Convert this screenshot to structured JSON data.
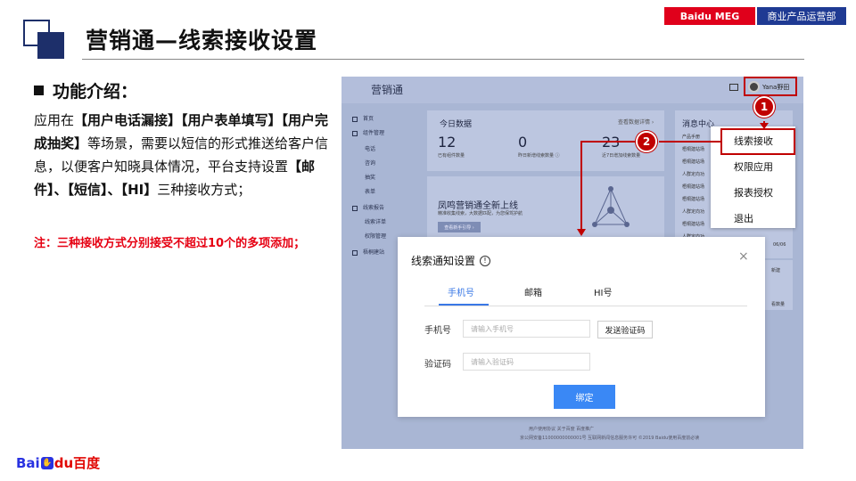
{
  "header": {
    "tag_meg": "Baidu MEG",
    "tag_dept": "商业产品运营部",
    "title": "营销通—线索接收设置"
  },
  "intro": {
    "heading": "功能介绍：",
    "line1_prefix": "应用在",
    "s1": "【用户电话漏接】",
    "s2": "【用户表单填写】",
    "s3": "【用户完成抽奖】",
    "line2_rest": "等场景，需要以短信的形式推送给客户信息，以便客户知晓具体情况，平台支持设置",
    "m1": "【邮件】",
    "sep1": "、",
    "m2": "【短信】",
    "sep2": "、",
    "m3": "【HI】",
    "tail": "三种接收方式；",
    "note": "注：三种接收方式分别接受不超过10个的多项添加；"
  },
  "logo": {
    "bai": "Bai",
    "du": "du",
    "cn": "百度"
  },
  "app": {
    "brand": "营销通",
    "user": "Yana野田",
    "sidebar": [
      "首页",
      "组件管理",
      "电话",
      "咨询",
      "抽奖",
      "表单",
      "线索报告",
      "线索详单",
      "权限管理",
      "梧桐建站"
    ],
    "today_title": "今日数据",
    "today_link": "查看数据详情 ›",
    "metrics": [
      {
        "value": "12",
        "label": "已有组件数量"
      },
      {
        "value": "0",
        "label": "昨日新增线索数量 ⓘ"
      },
      {
        "value": "23",
        "label": "近7日增加线索数量"
      }
    ],
    "promo_title": "凤鸣营销通全新上线",
    "promo_sub": "精准收集线索，大数据匹配，为您保驾护航",
    "promo_btn": "查看新手引导 ›",
    "msg_title": "消息中心",
    "msgs": [
      "产品手册",
      "梧桐建站场",
      "梧桐建站场",
      "人群定向功",
      "梧桐建站场",
      "梧桐建站场",
      "人群定向功",
      "梧桐建站场",
      "人群定向功"
    ],
    "msg_date": "06/06",
    "card4_a": "新建",
    "card4_b": "看数量",
    "footer1": "用户使用协议    关于百度    百度推广",
    "footer2": "京公网安备11000000000001号 互联网新闻信息服务许可 ©2019 Baidu使用百度前必读"
  },
  "menu": {
    "items": [
      "线索接收",
      "权限应用",
      "报表授权",
      "退出"
    ]
  },
  "badges": {
    "b1": "1",
    "b2": "2"
  },
  "modal": {
    "title": "线索通知设置",
    "close": "×",
    "tabs": [
      "手机号",
      "邮箱",
      "HI号"
    ],
    "phone_label": "手机号",
    "phone_placeholder": "请输入手机号",
    "send_code": "发送验证码",
    "code_label": "验证码",
    "code_placeholder": "请输入验证码",
    "submit": "绑定"
  },
  "colors": {
    "accent_red": "#c00000",
    "brand_blue": "#1f3a93",
    "primary_button": "#3a88f5"
  }
}
